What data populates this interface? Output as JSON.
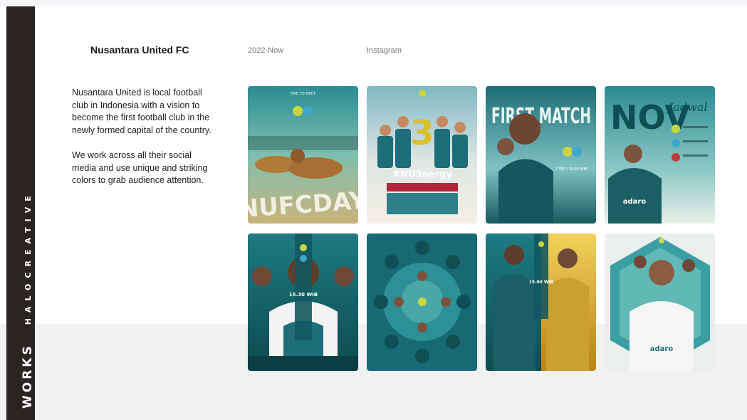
{
  "sidebar": {
    "brand_strong": "WORKS",
    "brand_light": "HALOCREATIVE"
  },
  "project": {
    "client": "Nusantara United FC",
    "period": "2022-Now",
    "platform": "Instagram",
    "description": [
      "Nusantara United is local football club in Indonesia with a vision to become the first football club in the newly formed capital of the country.",
      "We work across all their social media and use unique and striking colors to grab audience attention."
    ]
  },
  "gallery": [
    {
      "name": "nufcday-leopards-poster",
      "caption": "NUFCDAY",
      "tagline": "TIME TO MEET"
    },
    {
      "name": "nu3nergy-squad-poster",
      "caption": "#NU3nergy",
      "badge": "3"
    },
    {
      "name": "first-match-poster",
      "caption": "FIRST MATCH",
      "detail": "7 SEP | 15.00 WIB"
    },
    {
      "name": "jadwal-nov-poster",
      "caption": "NOV",
      "subtitle": "Jadwal"
    },
    {
      "name": "matchday-kickoff-1530-poster",
      "caption": "15.30 WIB"
    },
    {
      "name": "kaleidoscope-players-poster",
      "caption": ""
    },
    {
      "name": "matchday-1500-gold-poster",
      "caption": "15.00 WIB"
    },
    {
      "name": "hush-celebration-poster",
      "caption": ""
    }
  ],
  "colors": {
    "sidebar": "#2a2423",
    "teal": "#1e7f86",
    "teal_dark": "#0d4f55",
    "gold": "#d9a521"
  }
}
